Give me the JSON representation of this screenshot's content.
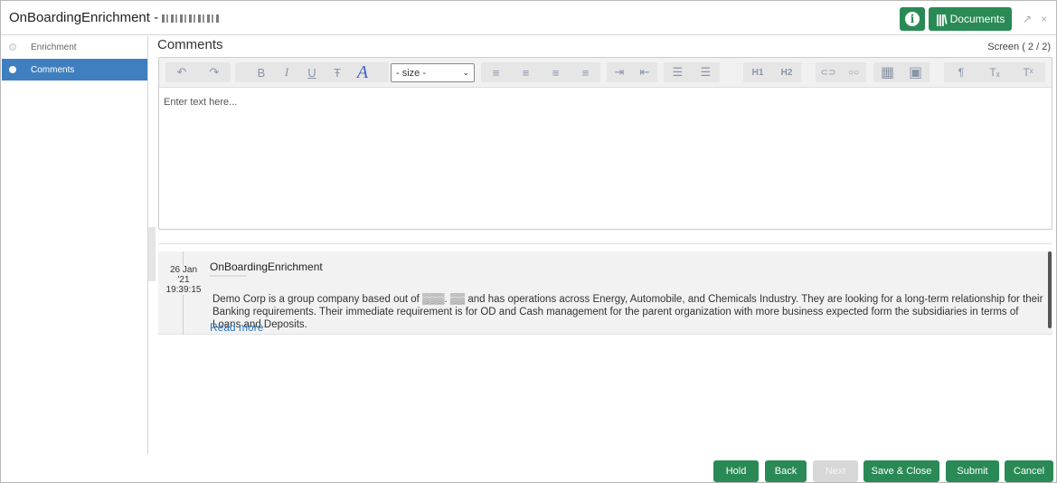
{
  "window": {
    "title": "OnBoardingEnrichment -",
    "docs_label": "Documents",
    "info_glyph": "i",
    "minimize_glyph": "↗",
    "close_glyph": "×",
    "accent_color": "#2a8a55"
  },
  "sidebar": {
    "items": [
      {
        "label": "Enrichment",
        "active": false
      },
      {
        "label": "Comments",
        "active": true
      }
    ],
    "active_color": "#3f7fbf"
  },
  "main": {
    "title": "Comments",
    "screen_indicator": "Screen ( 2 / 2)"
  },
  "editor": {
    "size_select": "- size -",
    "placeholder": "Enter text here...",
    "toolbar_icons": [
      {
        "name": "undo-icon",
        "glyph": "↶"
      },
      {
        "name": "redo-icon",
        "glyph": "↷"
      },
      {
        "name": "bold-icon",
        "glyph": "B"
      },
      {
        "name": "italic-icon",
        "glyph": "I"
      },
      {
        "name": "underline-icon",
        "glyph": "U"
      },
      {
        "name": "strikethrough-icon",
        "glyph": "Ŧ"
      },
      {
        "name": "font-icon",
        "glyph": "A"
      },
      {
        "name": "align-left-icon",
        "glyph": "≡"
      },
      {
        "name": "align-center-icon",
        "glyph": "≡"
      },
      {
        "name": "align-right-icon",
        "glyph": "≡"
      },
      {
        "name": "align-justify-icon",
        "glyph": "≡"
      },
      {
        "name": "indent-icon",
        "glyph": "⇥"
      },
      {
        "name": "outdent-icon",
        "glyph": "⇤"
      },
      {
        "name": "bullet-list-icon",
        "glyph": "☰"
      },
      {
        "name": "numbered-list-icon",
        "glyph": "☰"
      },
      {
        "name": "heading1-icon",
        "glyph": "H1"
      },
      {
        "name": "heading2-icon",
        "glyph": "H2"
      },
      {
        "name": "link-icon",
        "glyph": "⊂⊃"
      },
      {
        "name": "unlink-icon",
        "glyph": "○○"
      },
      {
        "name": "table-icon",
        "glyph": "▦"
      },
      {
        "name": "table-edit-icon",
        "glyph": "▣"
      },
      {
        "name": "paragraph-icon",
        "glyph": "¶"
      },
      {
        "name": "subscript-icon",
        "glyph": "Tₓ"
      },
      {
        "name": "superscript-icon",
        "glyph": "Tˣ"
      }
    ]
  },
  "comments": [
    {
      "date_day": "26 Jan",
      "date_year": "'21",
      "time": "19:39:15",
      "author": "OnBoardingEnrichment",
      "text": "Demo Corp is a group company based out of ▒▒▒. ▒▒ and has operations across Energy, Automobile, and Chemicals Industry. They are looking for a long-term relationship for their Banking requirements. Their immediate requirement is for OD and Cash management for the parent organization with more business expected form the subsidiaries in terms of Loans and Deposits.",
      "read_more": "Read more"
    }
  ],
  "footer": {
    "hold": "Hold",
    "back": "Back",
    "next": "Next",
    "save_close": "Save & Close",
    "submit": "Submit",
    "cancel": "Cancel"
  }
}
